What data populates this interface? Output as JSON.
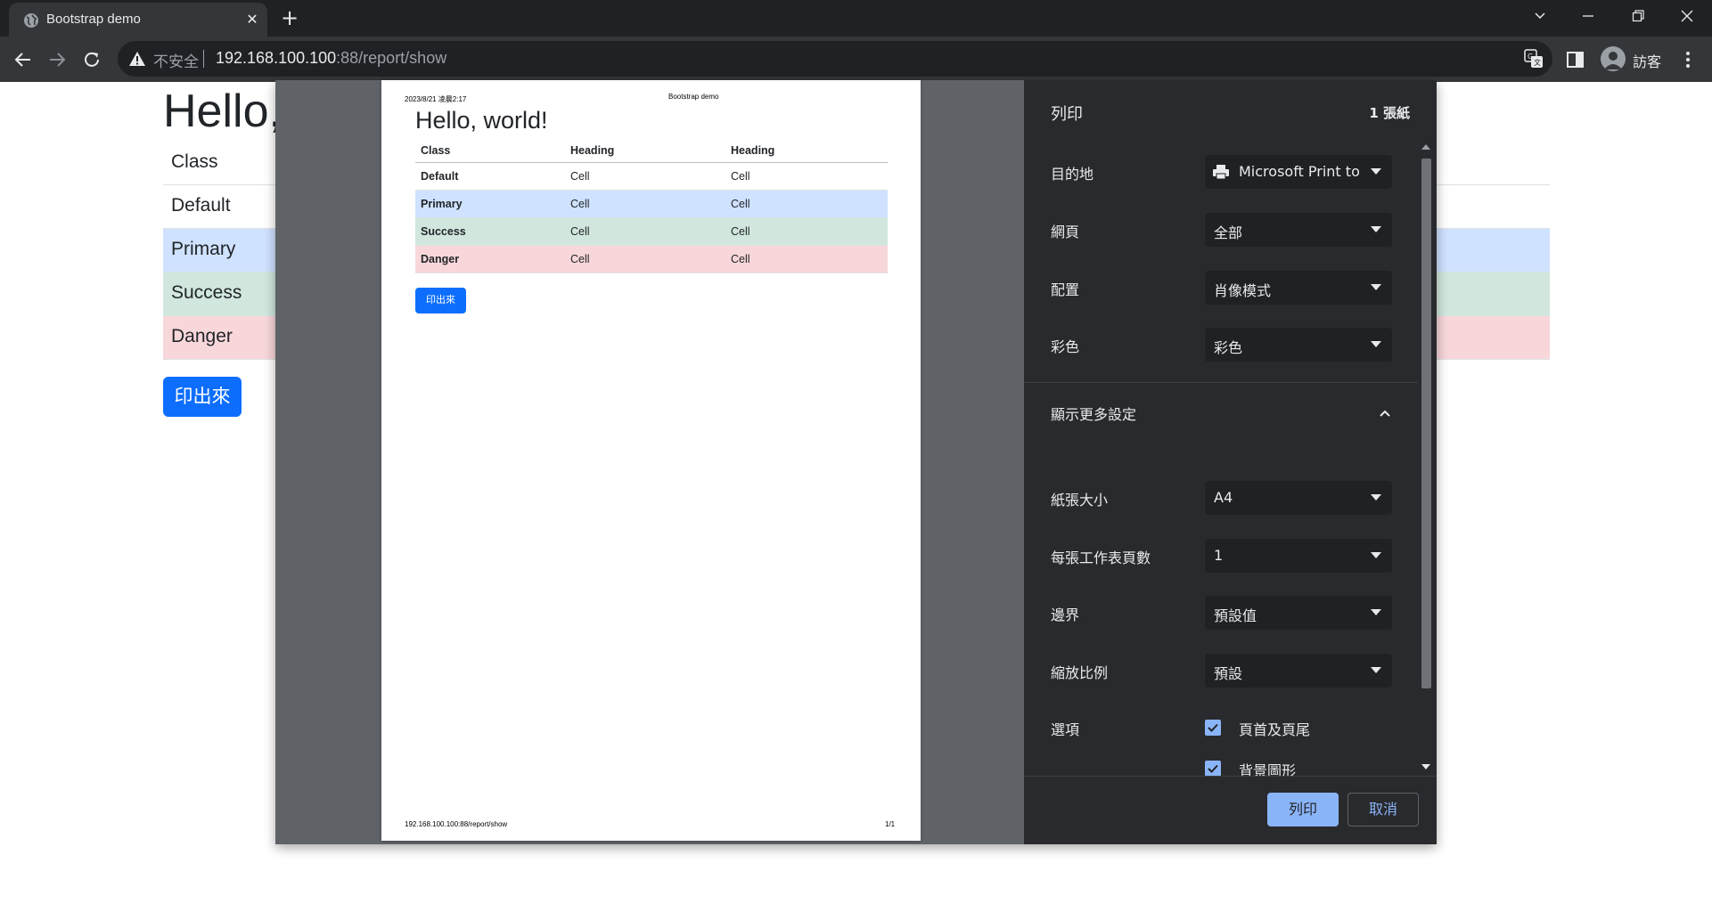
{
  "browser": {
    "tab_title": "Bootstrap demo",
    "security_label": "不安全",
    "url_host": "192.168.100.100",
    "url_rest": ":88/report/show",
    "profile_label": "訪客"
  },
  "page": {
    "title": "Hello,",
    "rows": [
      "Class",
      "Default",
      "Primary",
      "Success",
      "Danger"
    ],
    "button_label": "印出來"
  },
  "preview": {
    "date": "2023/8/21 凌晨2:17",
    "doc_title": "Bootstrap demo",
    "heading": "Hello, world!",
    "headers": [
      "Class",
      "Heading",
      "Heading"
    ],
    "rows": [
      {
        "label": "Default",
        "cells": [
          "Cell",
          "Cell"
        ]
      },
      {
        "label": "Primary",
        "cells": [
          "Cell",
          "Cell"
        ]
      },
      {
        "label": "Success",
        "cells": [
          "Cell",
          "Cell"
        ]
      },
      {
        "label": "Danger",
        "cells": [
          "Cell",
          "Cell"
        ]
      }
    ],
    "button_label": "印出來",
    "footer_url": "192.168.100.100:88/report/show",
    "page_counter": "1/1"
  },
  "print": {
    "title": "列印",
    "sheets": "1 張紙",
    "destination": {
      "label": "目的地",
      "value": "Microsoft Print to P"
    },
    "pages": {
      "label": "網頁",
      "value": "全部"
    },
    "layout": {
      "label": "配置",
      "value": "肖像模式"
    },
    "color": {
      "label": "彩色",
      "value": "彩色"
    },
    "more_settings": "顯示更多設定",
    "paper_size": {
      "label": "紙張大小",
      "value": "A4"
    },
    "pages_per_sheet": {
      "label": "每張工作表頁數",
      "value": "1"
    },
    "margins": {
      "label": "邊界",
      "value": "預設值"
    },
    "scale": {
      "label": "縮放比例",
      "value": "預設"
    },
    "options": {
      "label": "選項",
      "headers_footers": "頁首及頁尾",
      "background_graphics": "背景圖形"
    },
    "print_button": "列印",
    "cancel_button": "取消"
  },
  "colors": {
    "primary_row": "#cfe2ff",
    "success_row": "#d1e7dd",
    "danger_row": "#f8d7da",
    "bootstrap_primary": "#0d6efd",
    "dialog_accent": "#8ab4f8"
  }
}
